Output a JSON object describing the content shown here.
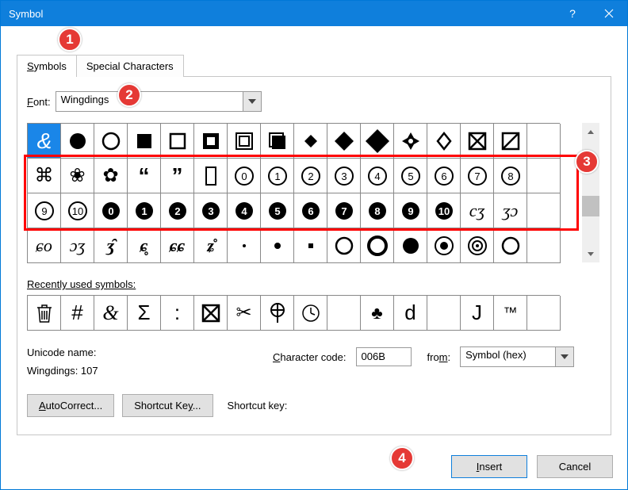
{
  "titlebar": {
    "title": "Symbol"
  },
  "tabs": {
    "symbols_prefix": "S",
    "symbols_rest": "ymbols",
    "special": "Special Characters"
  },
  "font": {
    "label_prefix": "F",
    "label_rest": "ont:",
    "value": "Wingdings"
  },
  "recent_label_prefix": "R",
  "recent_label_rest": "ecently used symbols:",
  "unicode_name_label": "Unicode name:",
  "unicode_name_value": "Wingdings: 107",
  "charcode": {
    "label_prefix": "C",
    "label_rest": "haracter code:",
    "value": "006B"
  },
  "from": {
    "label_prefix": "",
    "label_rest": "fro",
    "label_u": "m",
    "label_after": ":",
    "value": "Symbol (hex)"
  },
  "buttons": {
    "autocorrect_prefix": "A",
    "autocorrect_rest": "utoCorrect...",
    "shortcut": "Shortcut Ke",
    "shortcut_u": "y",
    "shortcut_after": "...",
    "shortcut_lbl": "Shortcut key:",
    "insert_prefix": "I",
    "insert_rest": "nsert",
    "cancel": "Cancel"
  },
  "callouts": {
    "c1": "1",
    "c2": "2",
    "c3": "3",
    "c4": "4"
  },
  "recent": [
    "🗑",
    "#",
    "&",
    "Σ",
    ":",
    "⊠",
    "✂",
    "✞",
    "◷",
    "",
    "♣",
    "d",
    "",
    "J",
    "™",
    ""
  ],
  "chart_data": {
    "type": "table",
    "title": "Symbol grid (Wingdings font)",
    "columns": 16,
    "rows": 4,
    "selected_cell": [
      0,
      0
    ],
    "rows_data": [
      [
        "&",
        "●",
        "○",
        "■",
        "□",
        "◧",
        "⧈",
        "⬒",
        "◆small",
        "◆",
        "◆big",
        "❖",
        "◊",
        "⊠",
        "◸",
        " "
      ],
      [
        "⌘",
        "❀",
        "✿",
        "❝",
        "❞",
        "▯",
        "⓪",
        "①",
        "②",
        "③",
        "④",
        "⑤",
        "⑥",
        "⑦",
        "⑧",
        " "
      ],
      [
        "⑨",
        "⑩",
        "⓿",
        "❶",
        "❷",
        "❸",
        "❹",
        "❺",
        "❻",
        "❼",
        "❽",
        "❾",
        "❿",
        "cs1",
        "cs2",
        " "
      ],
      [
        "sw1",
        "sw2",
        "sw3",
        "sw4",
        "sw5",
        "sw6",
        "·",
        "•",
        "▪",
        "○",
        "◎",
        "●",
        "◉",
        "⊚",
        "○",
        " "
      ]
    ]
  }
}
